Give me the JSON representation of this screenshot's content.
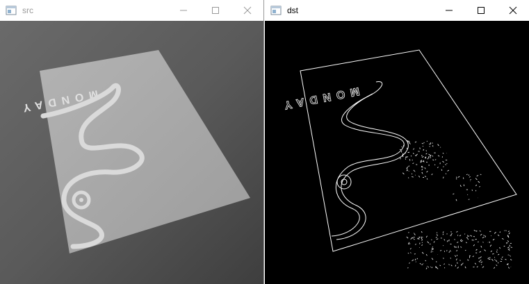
{
  "windows": {
    "src": {
      "title": "src",
      "image_description_icon": "app-window-icon"
    },
    "dst": {
      "title": "dst",
      "image_description_icon": "app-window-icon"
    }
  },
  "card_text": "MONDAY",
  "colors": {
    "titlebar_bg": "#ffffff",
    "src_bg": "#5e5e5e",
    "card": "#a9a9a9",
    "card_mark": "#dcdcdc",
    "dst_bg": "#000000",
    "edge": "#ffffff"
  }
}
